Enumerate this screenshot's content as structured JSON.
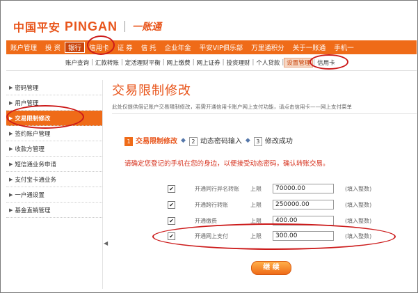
{
  "header": {
    "logo_cn": "中国平安",
    "logo_en": "PINGAN",
    "logo_sub": "一账通"
  },
  "nav": {
    "items": [
      {
        "label": "账户管理",
        "active": false
      },
      {
        "label": "投 资",
        "active": false
      },
      {
        "label": "银行",
        "active": true
      },
      {
        "label": "信用卡",
        "active": false
      },
      {
        "label": "证 券",
        "active": false
      },
      {
        "label": "信 托",
        "active": false
      },
      {
        "label": "企业年金",
        "active": false
      },
      {
        "label": "平安VIP俱乐部",
        "active": false
      },
      {
        "label": "万里通积分",
        "active": false
      },
      {
        "label": "关于一账通",
        "active": false
      },
      {
        "label": "手机一",
        "active": false
      }
    ]
  },
  "subnav": {
    "items": [
      {
        "label": "账户查询",
        "active": false
      },
      {
        "label": "汇款转账",
        "active": false
      },
      {
        "label": "定活理财平衡",
        "active": false
      },
      {
        "label": "网上缴费",
        "active": false
      },
      {
        "label": "网上证券",
        "active": false
      },
      {
        "label": "投资理财",
        "active": false
      },
      {
        "label": "个人贷款",
        "active": false
      },
      {
        "label": "设置管理",
        "active": true
      },
      {
        "label": "信用卡",
        "active": false
      }
    ]
  },
  "sidebar": {
    "items": [
      {
        "label": "密码管理",
        "active": false
      },
      {
        "label": "用户管理",
        "active": false
      },
      {
        "label": "交易限制修改",
        "active": true
      },
      {
        "label": "签约账户管理",
        "active": false
      },
      {
        "label": "收款方管理",
        "active": false
      },
      {
        "label": "短信通业务申请",
        "active": false
      },
      {
        "label": "支付宝卡通业务",
        "active": false
      },
      {
        "label": "一户通设置",
        "active": false
      },
      {
        "label": "基金直销管理",
        "active": false
      }
    ],
    "collapse_glyph": "◀"
  },
  "main": {
    "title": "交易限制修改",
    "description": "此处仅提供借记账户交易限制修改，若需开通信用卡账户网上支付功能，请点击信用卡——网上支付菜单",
    "steps": [
      {
        "num": "1",
        "label": "交易限制修改",
        "active": true
      },
      {
        "num": "2",
        "label": "动态密码输入",
        "active": false
      },
      {
        "num": "3",
        "label": "修改成功",
        "active": false
      }
    ],
    "notice": "请确定您登记的手机在您的身边，以便接受动态密码，确认转账交易。",
    "limits": [
      {
        "checked": true,
        "label": "开通同行异名转账",
        "limit_label": "上限",
        "value": "70000.00",
        "hint": "(填入整数)"
      },
      {
        "checked": true,
        "label": "开通跨行转账",
        "limit_label": "上限",
        "value": "250000.00",
        "hint": "(填入整数)"
      },
      {
        "checked": true,
        "label": "开通缴费",
        "limit_label": "上限",
        "value": "400.00",
        "hint": "(填入整数)"
      },
      {
        "checked": true,
        "label": "开通网上支付",
        "limit_label": "上限",
        "value": "300.00",
        "hint": "(填入整数)"
      }
    ],
    "continue_label": "继 续"
  },
  "colors": {
    "brand_orange": "#ef6b18",
    "highlight_red": "#cc1a1a",
    "notice_red": "#d6301c"
  }
}
